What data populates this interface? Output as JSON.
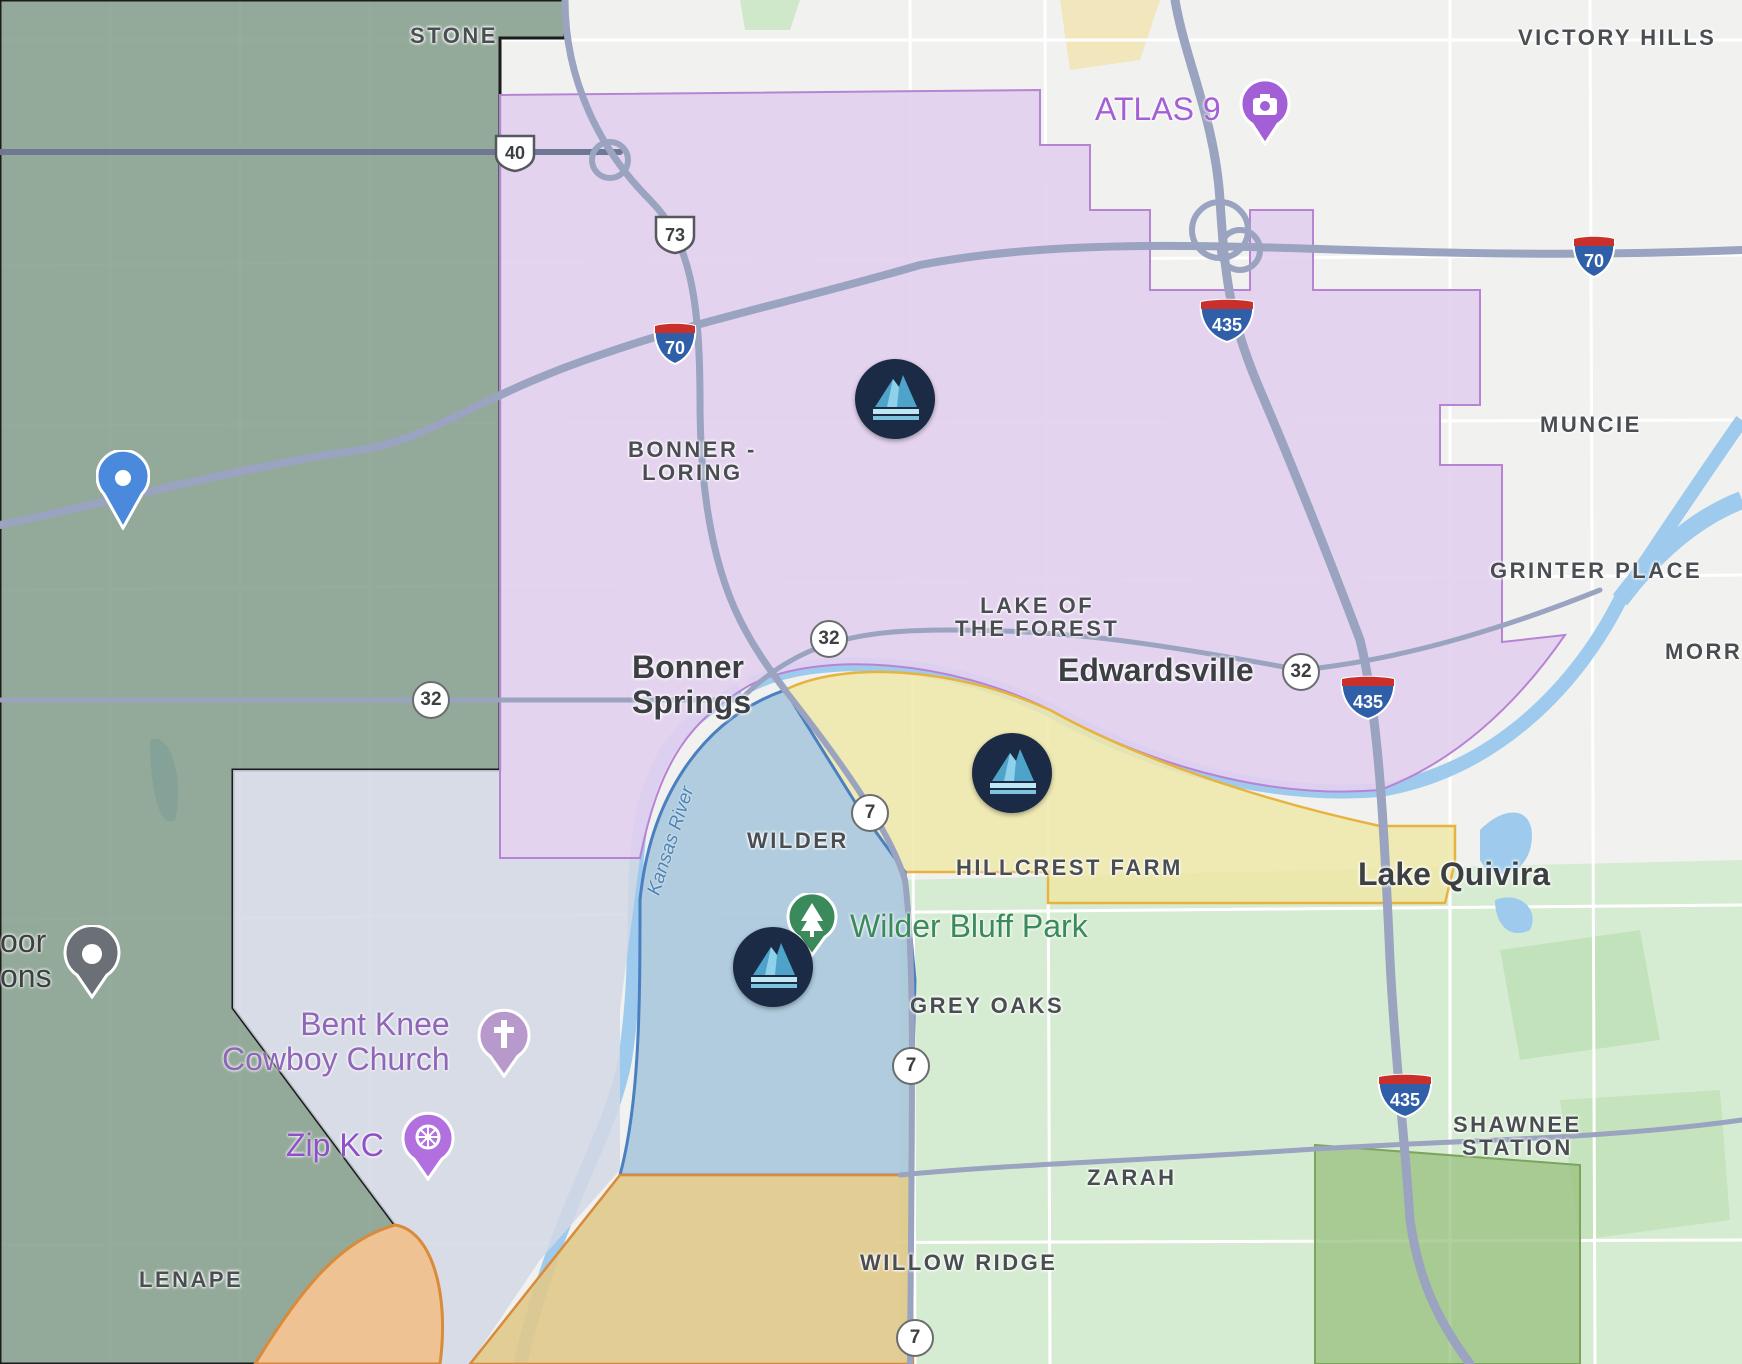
{
  "map": {
    "neighborhoods": {
      "stone": "STONE",
      "victory_hills": "VICTORY HILLS",
      "muncie": "MUNCIE",
      "bonner_loring": "BONNER -\nLORING",
      "grinter_place": "GRINTER PLACE",
      "morris": "MORRI",
      "lake_of_the_forest": "LAKE OF\nTHE FOREST",
      "wilder": "WILDER",
      "hillcrest_farm": "HILLCREST FARM",
      "grey_oaks": "GREY OAKS",
      "shawnee_station": "SHAWNEE\nSTATION",
      "zarah": "ZARAH",
      "willow_ridge": "WILLOW RIDGE",
      "lenape": "LENAPE"
    },
    "cities": {
      "bonner_springs": "Bonner\nSprings",
      "edwardsville": "Edwardsville",
      "lake_quivira": "Lake Quivira"
    },
    "pois": {
      "atlas_9": "ATLAS 9",
      "wilder_bluff_park": "Wilder Bluff Park",
      "bent_knee": "Bent Knee\nCowboy Church",
      "zip_kc": "Zip KC",
      "partial_poi": "oor\nons"
    },
    "water": {
      "kansas_river": "Kansas River"
    },
    "highway_shields": {
      "us40": "40",
      "us73": "73",
      "i70_west": "70",
      "i70_east": "70",
      "i435_north": "435",
      "i435_mid": "435",
      "i435_south": "435",
      "k32_west": "32",
      "k32_mid": "32",
      "k32_east": "32",
      "k7_north": "7",
      "k7_mid": "7",
      "k7_south": "7"
    },
    "colors": {
      "zone_purple": "#e2cfee",
      "zone_darkgreen": "#7e9885",
      "zone_blue": "#a9c8dc",
      "zone_yellow": "#efe7a8",
      "zone_orange": "#e9c98f",
      "zone_green": "#97c07e",
      "marker_navy": "#1c2b45",
      "location_pin": "#4a89dc",
      "poi_purple": "#a25fd6",
      "park_green": "#3a8a5c"
    }
  }
}
